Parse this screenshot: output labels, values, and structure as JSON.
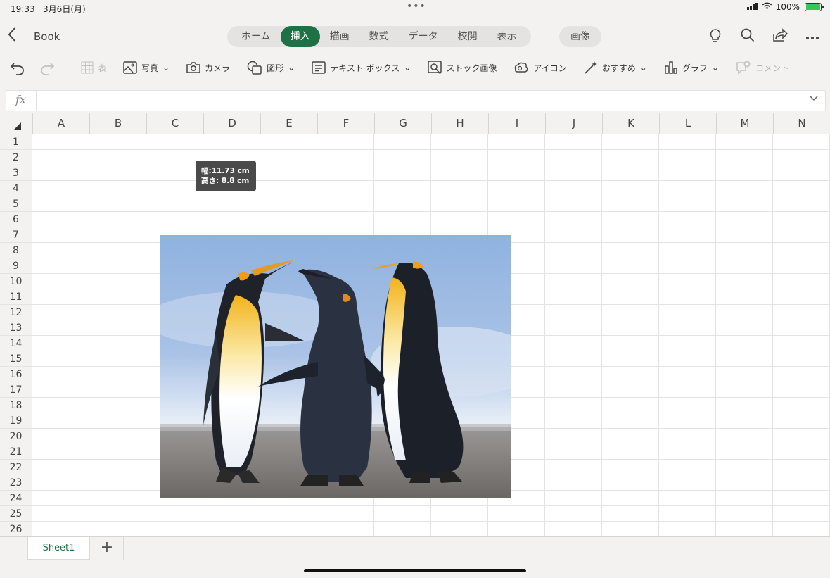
{
  "status_bar": {
    "time": "19:33",
    "date": "3月6日(月)",
    "battery": "100%"
  },
  "topbar": {
    "title": "Book",
    "tabs": [
      {
        "label": "ホーム"
      },
      {
        "label": "挿入",
        "active": true
      },
      {
        "label": "描画"
      },
      {
        "label": "数式"
      },
      {
        "label": "データ"
      },
      {
        "label": "校閲"
      },
      {
        "label": "表示"
      }
    ],
    "context_tab": "画像",
    "icons": [
      "lightbulb-icon",
      "search-icon",
      "share-icon",
      "more-icon"
    ]
  },
  "ribbon": {
    "table": "表",
    "photo": "写真",
    "camera": "カメラ",
    "shapes": "図形",
    "textbox": "テキスト ボックス",
    "stock": "ストック画像",
    "icons": "アイコン",
    "recommended": "おすすめ",
    "chart": "グラフ",
    "comment": "コメント"
  },
  "formula_bar": {
    "fx": "fx",
    "value": ""
  },
  "grid": {
    "columns": [
      "A",
      "B",
      "C",
      "D",
      "E",
      "F",
      "G",
      "H",
      "I",
      "J",
      "K",
      "L",
      "M",
      "N"
    ],
    "rows": [
      "1",
      "2",
      "3",
      "4",
      "5",
      "6",
      "7",
      "8",
      "9",
      "10",
      "11",
      "12",
      "13",
      "14",
      "15",
      "16",
      "17",
      "18",
      "19",
      "20",
      "21",
      "22",
      "23",
      "24",
      "25",
      "26"
    ]
  },
  "tooltip": {
    "width": "幅:11.73 cm",
    "height": "高さ: 8.8 cm"
  },
  "sheets": {
    "tabs": [
      "Sheet1"
    ],
    "add": "+"
  },
  "colors": {
    "accent": "#1e7145",
    "header_bg": "#f3f2f1",
    "grid_line": "#e3e3e3"
  }
}
